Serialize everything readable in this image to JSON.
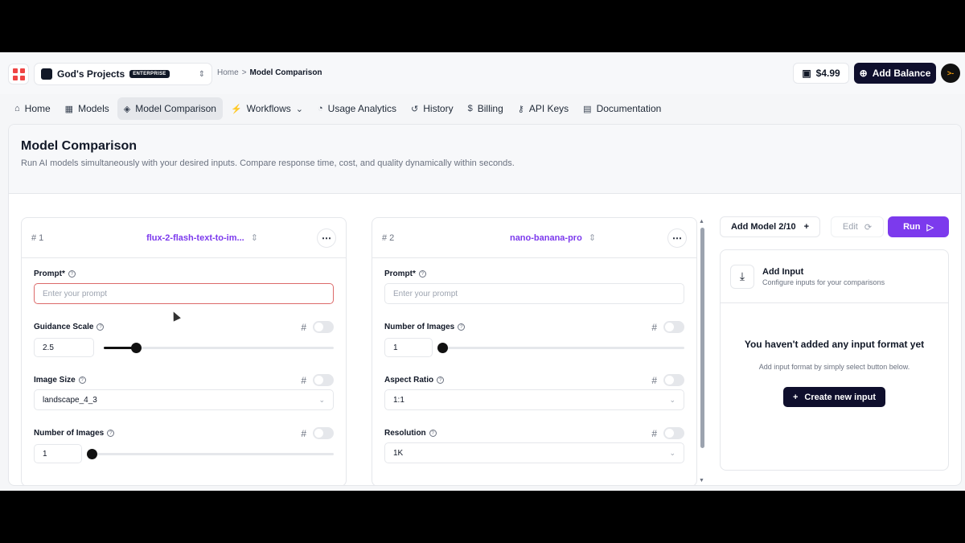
{
  "project": {
    "name": "God's Projects",
    "badge": "ENTERPRISE"
  },
  "breadcrumb": {
    "home": "Home",
    "sep": ">",
    "current": "Model Comparison"
  },
  "wallet": {
    "balance": "$4.99"
  },
  "add_balance": "Add Balance",
  "avatar": ">-",
  "nav": [
    {
      "label": "Home",
      "icon": "⌂"
    },
    {
      "label": "Models",
      "icon": "▦"
    },
    {
      "label": "Model Comparison",
      "icon": "◈"
    },
    {
      "label": "Workflows",
      "icon": "⚡"
    },
    {
      "label": "Usage Analytics",
      "icon": "◔"
    },
    {
      "label": "History",
      "icon": "↺"
    },
    {
      "label": "Billing",
      "icon": "$"
    },
    {
      "label": "API Keys",
      "icon": "⚷"
    },
    {
      "label": "Documentation",
      "icon": "▤"
    }
  ],
  "page": {
    "title": "Model Comparison",
    "subtitle": "Run AI models simultaneously with your desired inputs. Compare response time, cost, and quality dynamically within seconds."
  },
  "panel1": {
    "number": "# 1",
    "model": "flux-2-flash-text-to-im...",
    "prompt_label": "Prompt*",
    "prompt_placeholder": "Enter your prompt",
    "guidance_label": "Guidance Scale",
    "guidance_value": "2.5",
    "guidance_fraction": 0.14,
    "image_size_label": "Image Size",
    "image_size_value": "landscape_4_3",
    "num_images_label": "Number of Images",
    "num_images_value": "1",
    "num_images_fraction": 0.0,
    "hash": "#"
  },
  "panel2": {
    "number": "# 2",
    "model": "nano-banana-pro",
    "prompt_label": "Prompt*",
    "prompt_placeholder": "Enter your prompt",
    "num_images_label": "Number of Images",
    "num_images_value": "1",
    "num_images_fraction": 0.0,
    "aspect_label": "Aspect Ratio",
    "aspect_value": "1:1",
    "resolution_label": "Resolution",
    "resolution_value": "1K",
    "hash": "#"
  },
  "actions": {
    "add_model": "Add Model 2/10",
    "edit": "Edit",
    "run": "Run"
  },
  "input_box": {
    "title": "Add Input",
    "subtitle": "Configure inputs for your comparisons",
    "empty_title": "You haven't added any input format yet",
    "empty_sub": "Add input format by simply select button below.",
    "create": "Create new input"
  }
}
